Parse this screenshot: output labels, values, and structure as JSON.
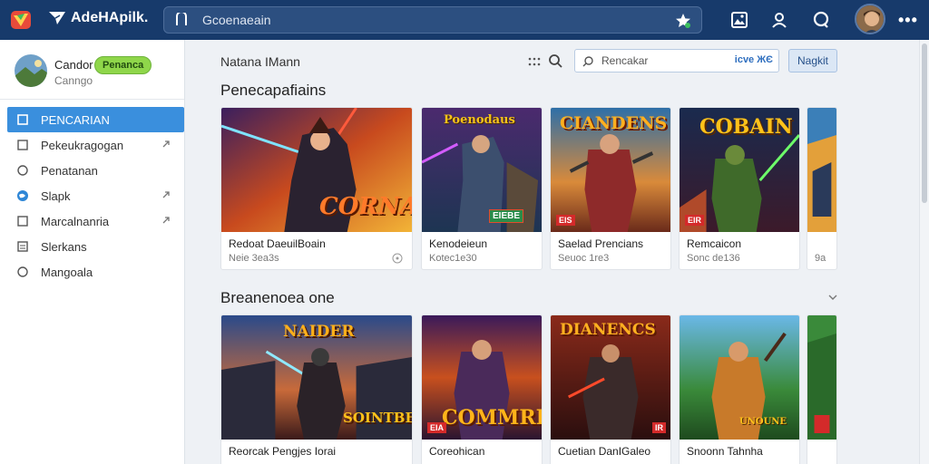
{
  "topbar": {
    "brand": "AdeHApilk.",
    "search_placeholder": "Gcoenaeain",
    "icons": [
      "app-logo-icon",
      "brand-bird-icon",
      "search-field-icon",
      "star-icon",
      "gallery-icon",
      "user-icon",
      "chat-icon",
      "avatar",
      "more-icon"
    ],
    "more": "•••"
  },
  "sidebar": {
    "profile": {
      "name": "Candor",
      "sub": "Canngo",
      "badge": "Penanca"
    },
    "items": [
      {
        "label": "PENCARIAN",
        "icon": "square-icon",
        "active": true
      },
      {
        "label": "Pekeukragogan",
        "icon": "square-icon",
        "arrow": true
      },
      {
        "label": "Penatanan",
        "icon": "circle-icon"
      },
      {
        "label": "Slapk",
        "icon": "globe-icon",
        "arrow": true
      },
      {
        "label": "Marcalnanria",
        "icon": "square-icon",
        "arrow": true
      },
      {
        "label": "Slerkans",
        "icon": "list-icon"
      },
      {
        "label": "Mangoala",
        "icon": "circle-icon"
      }
    ]
  },
  "main": {
    "breadcrumb": "Natana IMann",
    "filter": {
      "placeholder": "Rencakar",
      "code": "icve ЖЄ"
    },
    "button": "Nagkit",
    "section1": {
      "title": "Penecapafiains",
      "cards": [
        {
          "title": "Redoat DaeuilBoain",
          "meta": "Neie 3ea3s",
          "art_text": "CORNAR"
        },
        {
          "title": "Kenodeieun",
          "meta": "Kotec1e30",
          "art_text": "Poenodaus",
          "badge": "EIEBE"
        },
        {
          "title": "Saelad Prencians",
          "meta": "Seuoc 1re3",
          "art_text": "CIANDENS",
          "badge": "EIS"
        },
        {
          "title": "Remcaicon",
          "meta": "Sonc de136",
          "art_text": "COBAIN",
          "badge": "EIR"
        },
        {
          "title": "",
          "meta": "9a",
          "art_text": ""
        }
      ]
    },
    "section2": {
      "title": "Breanenoea one",
      "cards": [
        {
          "title": "Reorcak Pengjes Iorai",
          "meta": "",
          "art_text": "NAIDER",
          "art_text2": "SOINTBEE"
        },
        {
          "title": "Coreohican",
          "meta": "",
          "art_text": "COMMRR",
          "badge": "EIA"
        },
        {
          "title": "Cuetian DanIGaleo",
          "meta": "",
          "art_text": "DIANENCS",
          "badge": "IR"
        },
        {
          "title": "Snoonn Tahnha",
          "meta": "",
          "art_text": "UNOUNE"
        },
        {
          "title": "",
          "meta": "",
          "art_text": ""
        }
      ]
    }
  },
  "colors": {
    "topbar": "#173a6b",
    "accent": "#3a8fdd",
    "badge": "#8fd64a"
  }
}
